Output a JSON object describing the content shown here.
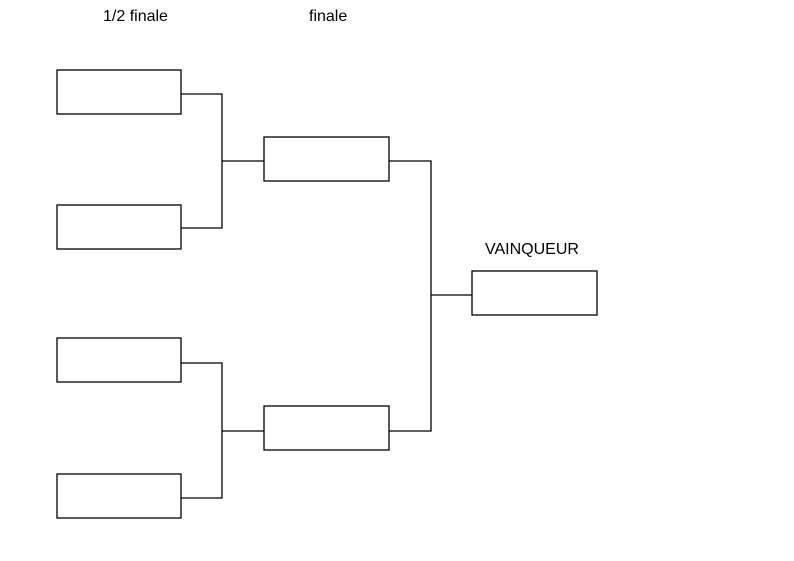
{
  "headers": {
    "semifinal": "1/2 finale",
    "final": "finale",
    "winner": "VAINQUEUR"
  },
  "bracket": {
    "semifinal_slots": [
      "",
      "",
      "",
      ""
    ],
    "final_slots": [
      "",
      ""
    ],
    "winner_slot": ""
  },
  "colors": {
    "lines": "#000000",
    "background": "#ffffff"
  }
}
